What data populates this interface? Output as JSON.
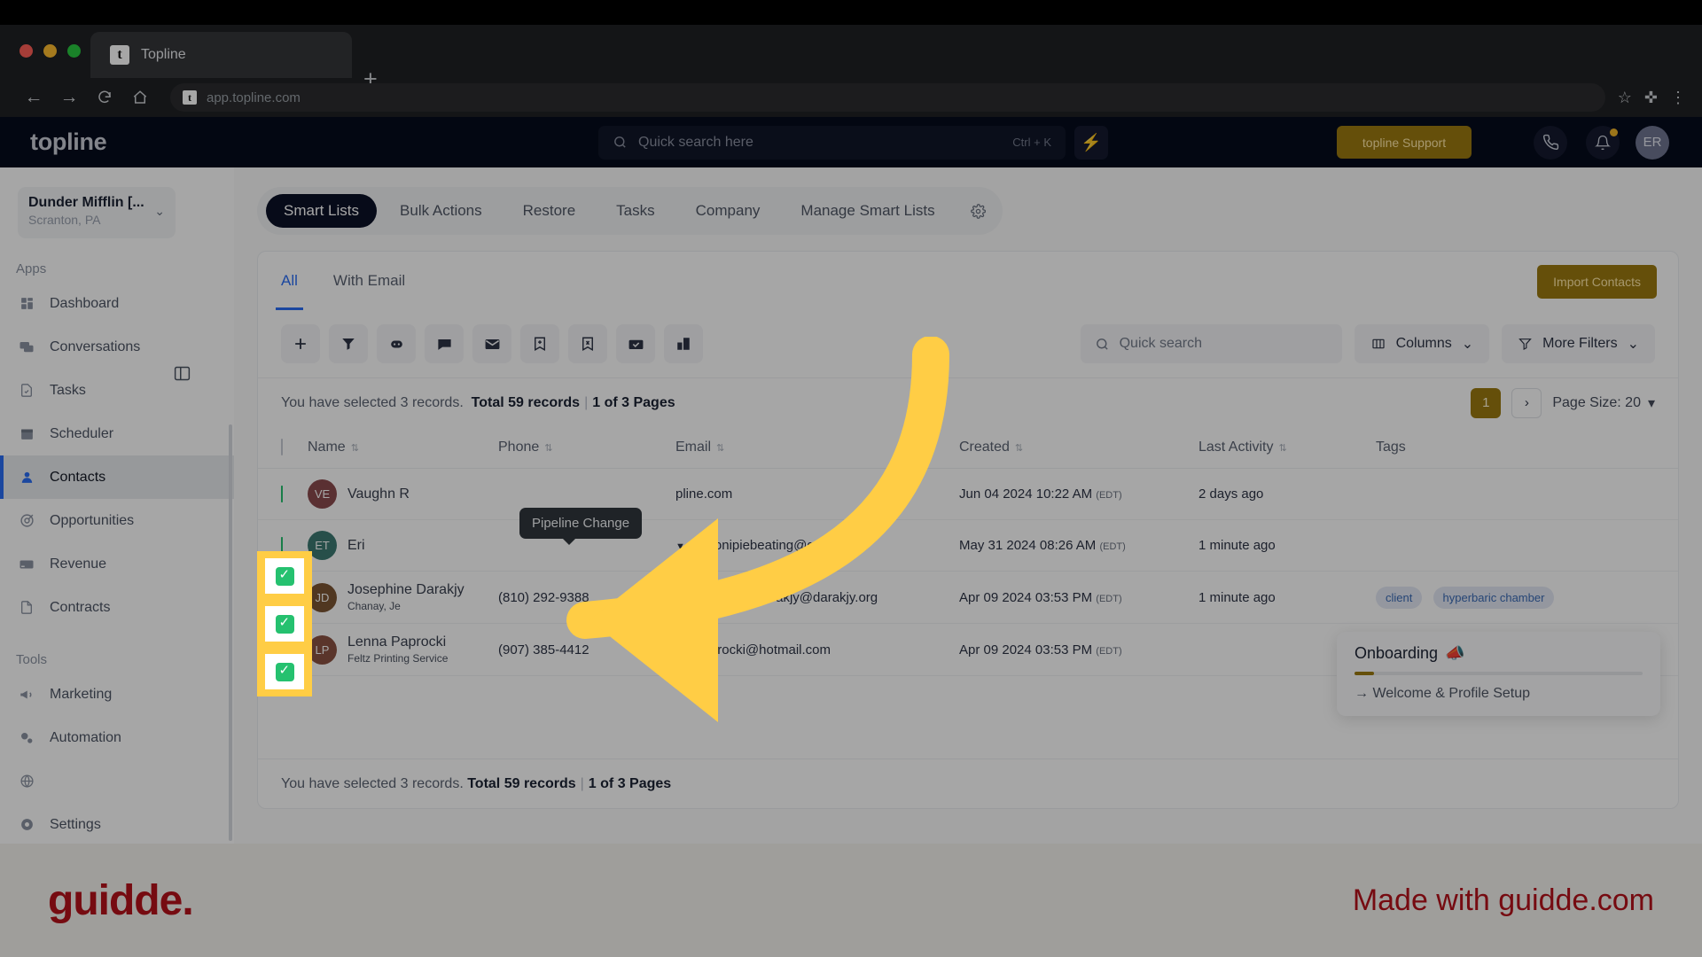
{
  "browser": {
    "tab_title": "Topline",
    "tab_favicon": "t",
    "new_tab": "+",
    "back": "←",
    "forward": "→",
    "reload": "C",
    "home": "⌂",
    "url": "app.topline.com",
    "star": "☆",
    "extensions": "✜",
    "menu": "⋮"
  },
  "header": {
    "brand": "topline",
    "search_placeholder": "Quick search here",
    "search_shortcut": "Ctrl + K",
    "bolt_icon": "⚡",
    "support_label": "topline Support",
    "phone_icon": "✆",
    "bell_icon": "🔔",
    "avatar_initials": "ER"
  },
  "sidebar": {
    "org_name": "Dunder Mifflin [...",
    "org_location": "Scranton, PA",
    "sections": [
      {
        "label": "Apps",
        "items": [
          {
            "label": "Dashboard",
            "icon": "dashboard"
          },
          {
            "label": "Conversations",
            "icon": "chat"
          },
          {
            "label": "Tasks",
            "icon": "task"
          },
          {
            "label": "Scheduler",
            "icon": "calendar"
          },
          {
            "label": "Contacts",
            "icon": "person",
            "active": true
          },
          {
            "label": "Opportunities",
            "icon": "target"
          },
          {
            "label": "Revenue",
            "icon": "card"
          },
          {
            "label": "Contracts",
            "icon": "doc"
          }
        ]
      },
      {
        "label": "Tools",
        "items": [
          {
            "label": "Marketing",
            "icon": "megaphone"
          },
          {
            "label": "Automation",
            "icon": "gears"
          },
          {
            "label": "",
            "icon": "globe"
          },
          {
            "label": "Settings",
            "icon": "gear"
          }
        ]
      }
    ]
  },
  "tabs": [
    {
      "label": "Smart Lists",
      "active": true
    },
    {
      "label": "Bulk Actions",
      "active": false
    },
    {
      "label": "Restore",
      "active": false
    },
    {
      "label": "Tasks",
      "active": false
    },
    {
      "label": "Company",
      "active": false
    },
    {
      "label": "Manage Smart Lists",
      "active": false
    }
  ],
  "subtabs": [
    {
      "label": "All",
      "active": true
    },
    {
      "label": "With Email",
      "active": false
    }
  ],
  "import_button": "Import Contacts",
  "tooltip": "Pipeline Change",
  "toolbar": {
    "icons": [
      {
        "name": "add-icon"
      },
      {
        "name": "filter-icon"
      },
      {
        "name": "bot-icon"
      },
      {
        "name": "sms-icon"
      },
      {
        "name": "email-icon"
      },
      {
        "name": "tag-add-icon"
      },
      {
        "name": "tag-remove-icon"
      },
      {
        "name": "mail-check-icon"
      },
      {
        "name": "company-icon"
      }
    ],
    "search_placeholder": "Quick search",
    "columns_label": "Columns",
    "more_filters_label": "More Filters"
  },
  "records": {
    "selected_text": "You have selected 3 records.",
    "total_text": "Total 59 records",
    "pages_text": "1 of 3 Pages",
    "separator": "|",
    "current_page": "1",
    "next_arrow": "›",
    "page_size_label": "Page Size: 20"
  },
  "table": {
    "columns": [
      "Name",
      "Phone",
      "Email",
      "Created",
      "Last Activity",
      "Tags"
    ],
    "rows": [
      {
        "checked": true,
        "initials": "VE",
        "color": "#8b4a4e",
        "name": "Vaughn R",
        "company": "",
        "phone": "",
        "email": "pline.com",
        "created": "Jun 04 2024 10:22 AM",
        "tz": "(EDT)",
        "last_activity": "2 days ago",
        "tags": []
      },
      {
        "checked": true,
        "initials": "ET",
        "color": "#3c7a72",
        "name": "Eri",
        "company": "",
        "phone": "",
        "email": "jabronipiebeating@gmail.com",
        "created": "May 31 2024 08:26 AM",
        "tz": "(EDT)",
        "last_activity": "1 minute ago",
        "tags": []
      },
      {
        "checked": true,
        "initials": "JD",
        "color": "#7b5533",
        "name": "Josephine Darakjy",
        "company": "Chanay, Je",
        "phone": "(810) 292-9388",
        "email": "josephine_darakjy@darakjy.org",
        "created": "Apr 09 2024 03:53 PM",
        "tz": "(EDT)",
        "last_activity": "1 minute ago",
        "tags": [
          "client",
          "hyperbaric chamber"
        ]
      },
      {
        "checked": false,
        "initials": "LP",
        "color": "#8a5242",
        "name": "Lenna Paprocki",
        "company": "Feltz Printing Service",
        "phone": "(907) 385-4412",
        "email": "lpaprocki@hotmail.com",
        "created": "Apr 09 2024 03:53 PM",
        "tz": "(EDT)",
        "last_activity": "",
        "tags": []
      }
    ]
  },
  "onboarding": {
    "title": "Onboarding",
    "emoji": "📣",
    "link": "→ Welcome & Profile Setup"
  },
  "footer": {
    "logo": "guidde.",
    "made_with": "Made with guidde.com"
  },
  "colors": {
    "accent_gold": "#9c7a10",
    "accent_blue": "#2a6df5",
    "highlight": "#ffcd45",
    "check_green": "#25c16f",
    "brand_red": "#b5121b"
  }
}
